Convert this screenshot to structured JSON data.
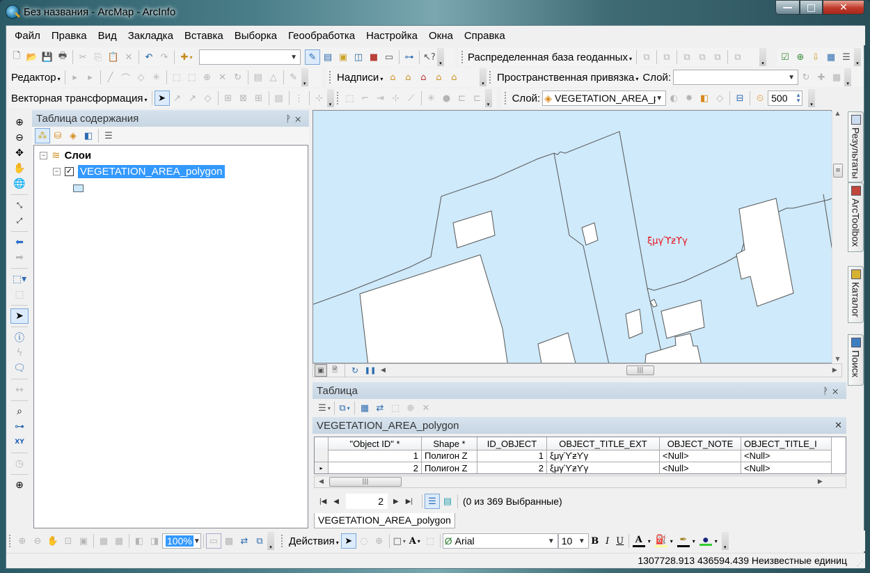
{
  "window": {
    "title": "Без названия - ArcMap - ArcInfo",
    "controls": {
      "minimize": "—",
      "maximize": "□",
      "close": "✕"
    }
  },
  "menubar": [
    "Файл",
    "Правка",
    "Вид",
    "Закладка",
    "Вставка",
    "Выборка",
    "Геообработка",
    "Настройка",
    "Окна",
    "Справка"
  ],
  "toolbars": {
    "standard": {
      "scale_value": ""
    },
    "distributed_gdb_label": "Распределенная база геоданных",
    "editor_label": "Редактор",
    "labeling_label": "Надписи",
    "georef_label": "Пространственная привязка",
    "georef_layer_label": "Слой:",
    "georef_layer_value": "",
    "spatial_adjust_label": "Векторная трансформация",
    "effects_layer_label": "Слой:",
    "effects_layer_value": "VEGETATION_AREA_polygon",
    "flicker_rate": "500"
  },
  "toc": {
    "title": "Таблица содержания",
    "pin": "ꟷ",
    "close": "✕",
    "root_label": "Слои",
    "layers": [
      {
        "name": "VEGETATION_AREA_polygon",
        "checked": true,
        "fill_color": "#cce7f8"
      }
    ]
  },
  "map": {
    "background_color": "#cfeafa",
    "feature_label": "ξμγϓƶϒγ",
    "label_color": "#e8101a"
  },
  "right_tabs": [
    "Результаты",
    "ArcToolbox",
    "Каталог",
    "Поиск"
  ],
  "table": {
    "title": "Таблица",
    "layer_title": "VEGETATION_AREA_polygon",
    "columns": [
      "\"Object ID\" *",
      "Shape *",
      "ID_OBJECT",
      "OBJECT_TITLE_EXT",
      "OBJECT_NOTE",
      "OBJECT_TITLE_I"
    ],
    "rows": [
      [
        "1",
        "Полигон Z",
        "1",
        "ξμγϓƶϒγ",
        "<Null>",
        "<Null>"
      ],
      [
        "2",
        "Полигон Z",
        "2",
        "ξμγϓƶϒγ",
        "<Null>",
        "<Null>"
      ]
    ],
    "current_record": "2",
    "selection_status": "(0 из 369 Выбранные)",
    "tab_label": "VEGETATION_AREA_polygon"
  },
  "bottom_toolbar": {
    "zoom_percent": "100%",
    "actions_label": "Действия",
    "font_name": "Arial",
    "font_size": "10",
    "bold": "B",
    "italic": "I",
    "underline": "U",
    "font_color": "#000000",
    "fill_color": "#ffff99",
    "line_color": "#000000",
    "marker_color": "#33cc33"
  },
  "status": {
    "coordinates": "1307728.913  436594.439 Неизвестные единиц"
  }
}
